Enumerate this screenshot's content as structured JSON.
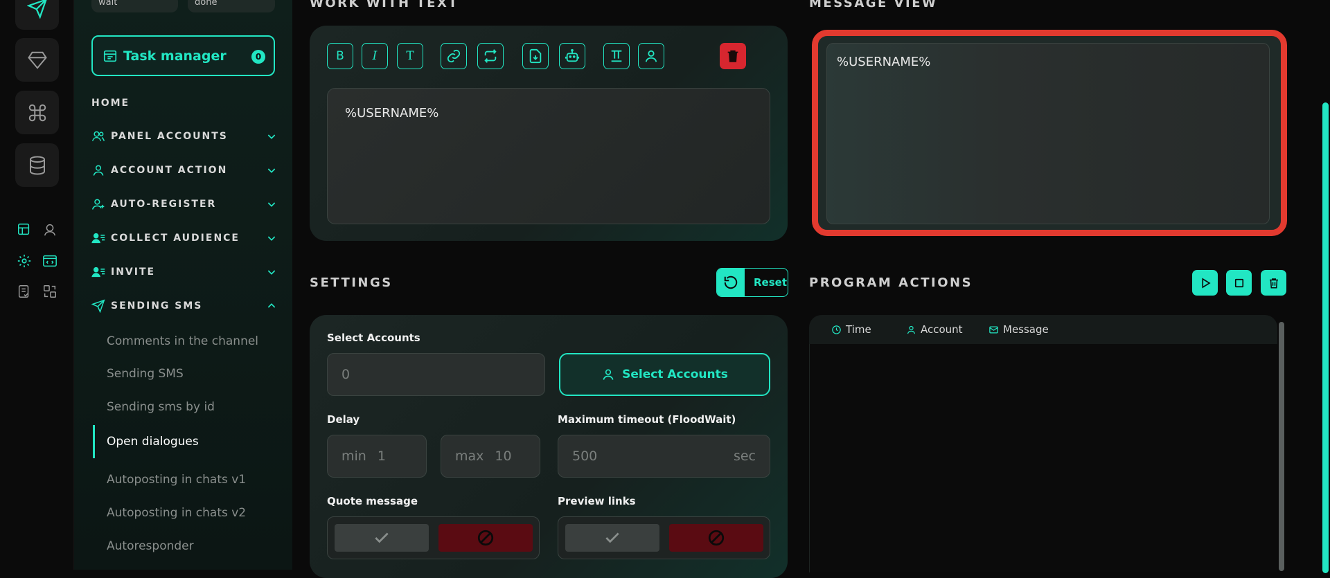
{
  "sidebar": {
    "pill_left": "wait",
    "pill_right": "done",
    "task_manager": {
      "label": "Task manager",
      "count": "0"
    },
    "home": "HOME",
    "items": [
      {
        "label": "PANEL ACCOUNTS",
        "icon": "users-icon",
        "expanded": false
      },
      {
        "label": "ACCOUNT ACTION",
        "icon": "user-icon",
        "expanded": false
      },
      {
        "label": "AUTO-REGISTER",
        "icon": "user-plus-icon",
        "expanded": false
      },
      {
        "label": "COLLECT AUDIENCE",
        "icon": "user-list-icon",
        "expanded": false
      },
      {
        "label": "INVITE",
        "icon": "user-list-icon",
        "expanded": false
      },
      {
        "label": "SENDING SMS",
        "icon": "send-icon",
        "expanded": true
      }
    ],
    "sub_items": [
      {
        "label": "Comments in the channel",
        "active": false
      },
      {
        "label": "Sending SMS",
        "active": false
      },
      {
        "label": "Sending sms by id",
        "active": false
      },
      {
        "label": "Open dialogues",
        "active": true
      },
      {
        "label": "Autoposting in chats v1",
        "active": false
      },
      {
        "label": "Autoposting in chats v2",
        "active": false
      },
      {
        "label": "Autoresponder",
        "active": false
      }
    ]
  },
  "work_with_text": {
    "title": "WORK WITH TEXT",
    "toolbar": [
      {
        "name": "bold-button",
        "glyph": "B",
        "icon": "bold-icon"
      },
      {
        "name": "italic-button",
        "glyph": "I",
        "icon": "italic-icon"
      },
      {
        "name": "text-button",
        "glyph": "T",
        "icon": "text-icon"
      },
      {
        "name": "link-button",
        "icon": "link-icon"
      },
      {
        "name": "repeat-button",
        "icon": "repeat-icon"
      },
      {
        "name": "import-file-button",
        "icon": "file-download-icon"
      },
      {
        "name": "bot-button",
        "icon": "robot-icon"
      },
      {
        "name": "format-text-button",
        "icon": "text-format-icon"
      },
      {
        "name": "username-button",
        "icon": "user-icon"
      }
    ],
    "delete_icon": "trash-icon",
    "text": "%USERNAME%"
  },
  "message_view": {
    "title": "MESSAGE VIEW",
    "text": "%USERNAME%"
  },
  "settings": {
    "title": "SETTINGS",
    "reset_label": "Reset",
    "select_accounts_label": "Select Accounts",
    "select_accounts_value": "0",
    "select_accounts_button": "Select Accounts",
    "delay_label": "Delay",
    "delay_min_label": "min",
    "delay_min_value": "1",
    "delay_max_label": "max",
    "delay_max_value": "10",
    "timeout_label": "Maximum timeout (FloodWait)",
    "timeout_value": "500",
    "timeout_unit": "sec",
    "quote_label": "Quote message",
    "preview_label": "Preview links"
  },
  "program_actions": {
    "title": "PROGRAM ACTIONS",
    "columns": [
      {
        "label": "Time",
        "icon": "clock-icon"
      },
      {
        "label": "Account",
        "icon": "user-icon"
      },
      {
        "label": "Message",
        "icon": "mail-icon"
      }
    ]
  },
  "colors": {
    "accent": "#22e6c3",
    "danger": "#d7262f",
    "highlight": "#e23a2f"
  }
}
